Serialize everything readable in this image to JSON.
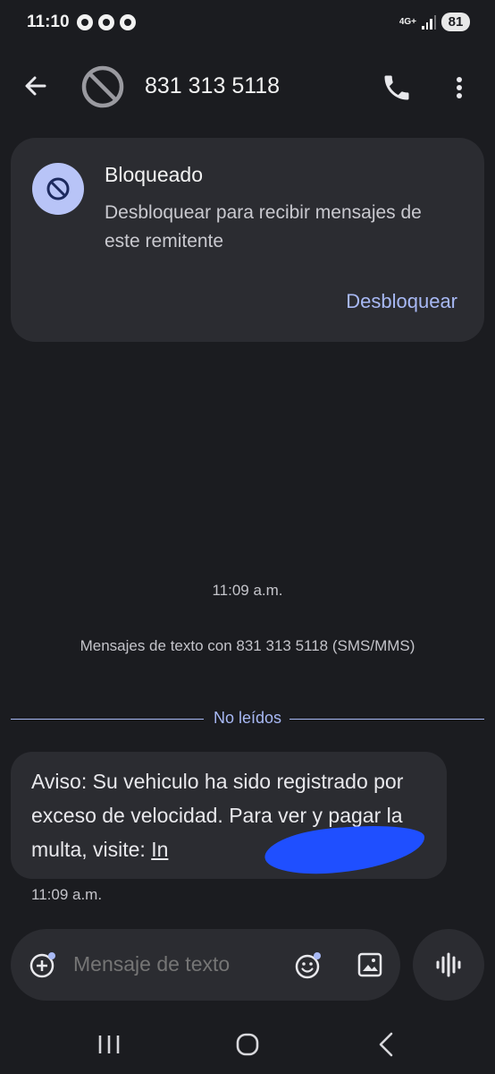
{
  "status_bar": {
    "time": "11:10",
    "network": "4G+",
    "battery": "81"
  },
  "app_bar": {
    "contact": "831 313 5118"
  },
  "block_card": {
    "title": "Bloqueado",
    "description": "Desbloquear para recibir mensajes de este remitente",
    "action": "Desbloquear"
  },
  "conversation": {
    "timestamp": "11:09 a.m.",
    "info": "Mensajes de texto con 831 313 5118 (SMS/MMS)",
    "unread_label": "No leídos",
    "message": {
      "text": "Aviso: Su vehiculo ha sido registrado por exceso de velocidad. Para ver y pagar la multa, visite: ",
      "link": "In",
      "time": "11:09 a.m."
    }
  },
  "composer": {
    "placeholder": "Mensaje de texto"
  },
  "colors": {
    "background": "#1b1c20",
    "surface": "#2b2c31",
    "accent": "#a8b9f5",
    "avatar_bg": "#b8c4f7",
    "redaction": "#1f4fff"
  },
  "icons": [
    "back-arrow-icon",
    "blocked-icon",
    "phone-icon",
    "more-vert-icon",
    "add-circle-icon",
    "emoji-icon",
    "gallery-icon",
    "voice-waveform-icon",
    "recents-icon",
    "home-icon",
    "nav-back-icon"
  ]
}
